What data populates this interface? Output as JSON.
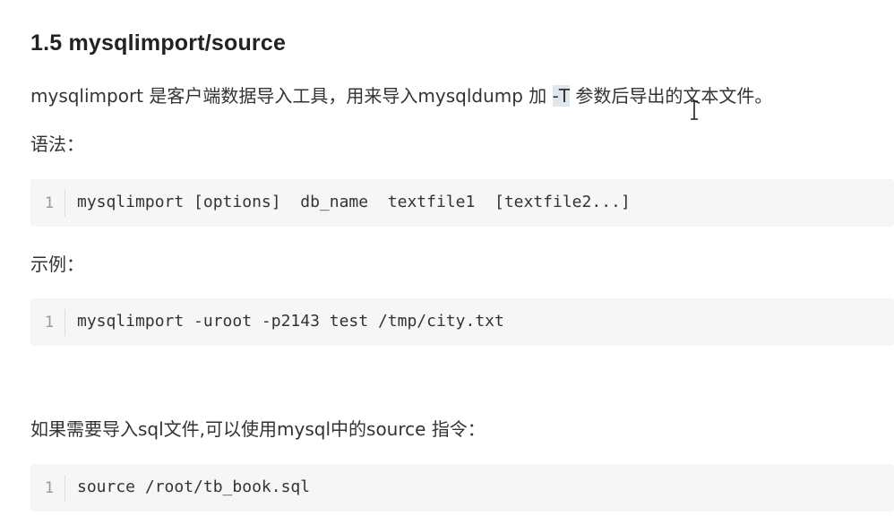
{
  "section": {
    "title": "1.5 mysqlimport/source"
  },
  "intro": {
    "before": "mysqlimport 是客户端数据导入工具，用来导入mysqldump 加 ",
    "highlight": "-T",
    "after": " 参数后导出的文本文件。"
  },
  "syntax": {
    "label": "语法：",
    "line_number": "1",
    "code": "mysqlimport [options]  db_name  textfile1  [textfile2...]"
  },
  "example": {
    "label": "示例：",
    "line_number": "1",
    "code": "mysqlimport -uroot -p2143 test /tmp/city.txt"
  },
  "source_section": {
    "text": "如果需要导入sql文件,可以使用mysql中的source 指令：",
    "line_number": "1",
    "code": "source /root/tb_book.sql"
  },
  "icons": {
    "cursor": "text-cursor-icon"
  }
}
